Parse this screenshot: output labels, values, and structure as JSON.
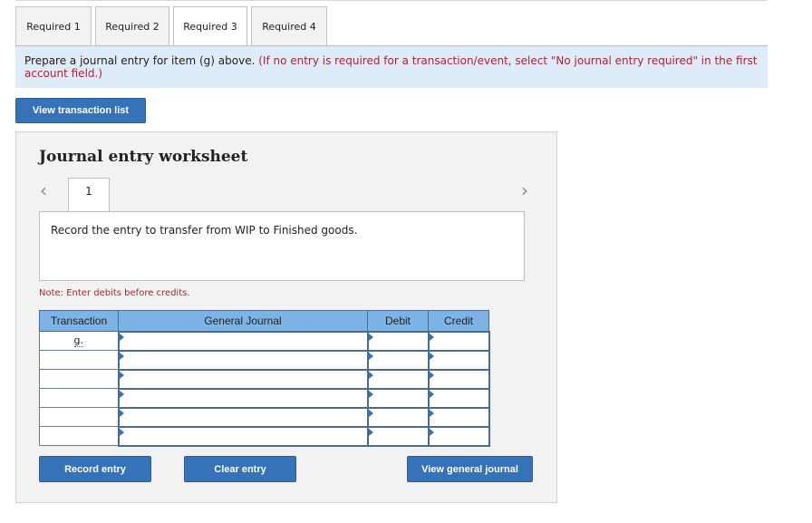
{
  "tabs": [
    "Required 1",
    "Required 2",
    "Required 3",
    "Required 4"
  ],
  "active_tab": "Required 3",
  "instructions": {
    "main": "Prepare a journal entry for item (g) above.",
    "hint": "(If no entry is required for a transaction/event, select \"No journal entry required\" in the first account field.)"
  },
  "view_transaction_list": "View transaction list",
  "worksheet": {
    "title": "Journal entry worksheet",
    "current_step": "1",
    "description": "Record the entry to transfer from WIP to Finished goods.",
    "note": "Note: Enter debits before credits.",
    "columns": [
      "Transaction",
      "General Journal",
      "Debit",
      "Credit"
    ],
    "rows": [
      {
        "transaction": "g."
      },
      {
        "transaction": ""
      },
      {
        "transaction": ""
      },
      {
        "transaction": ""
      },
      {
        "transaction": ""
      },
      {
        "transaction": ""
      }
    ],
    "buttons": {
      "record": "Record entry",
      "clear": "Clear entry",
      "view_journal": "View general journal"
    }
  },
  "icons": {
    "prev": "chevron-left-icon",
    "next": "chevron-right-icon",
    "cell_marker": "triangle-marker-icon"
  },
  "colors": {
    "button": "#3572b7",
    "table_header": "#7eb3e6",
    "instruction_bg": "#deecf9",
    "hint_text": "#b0222e"
  }
}
